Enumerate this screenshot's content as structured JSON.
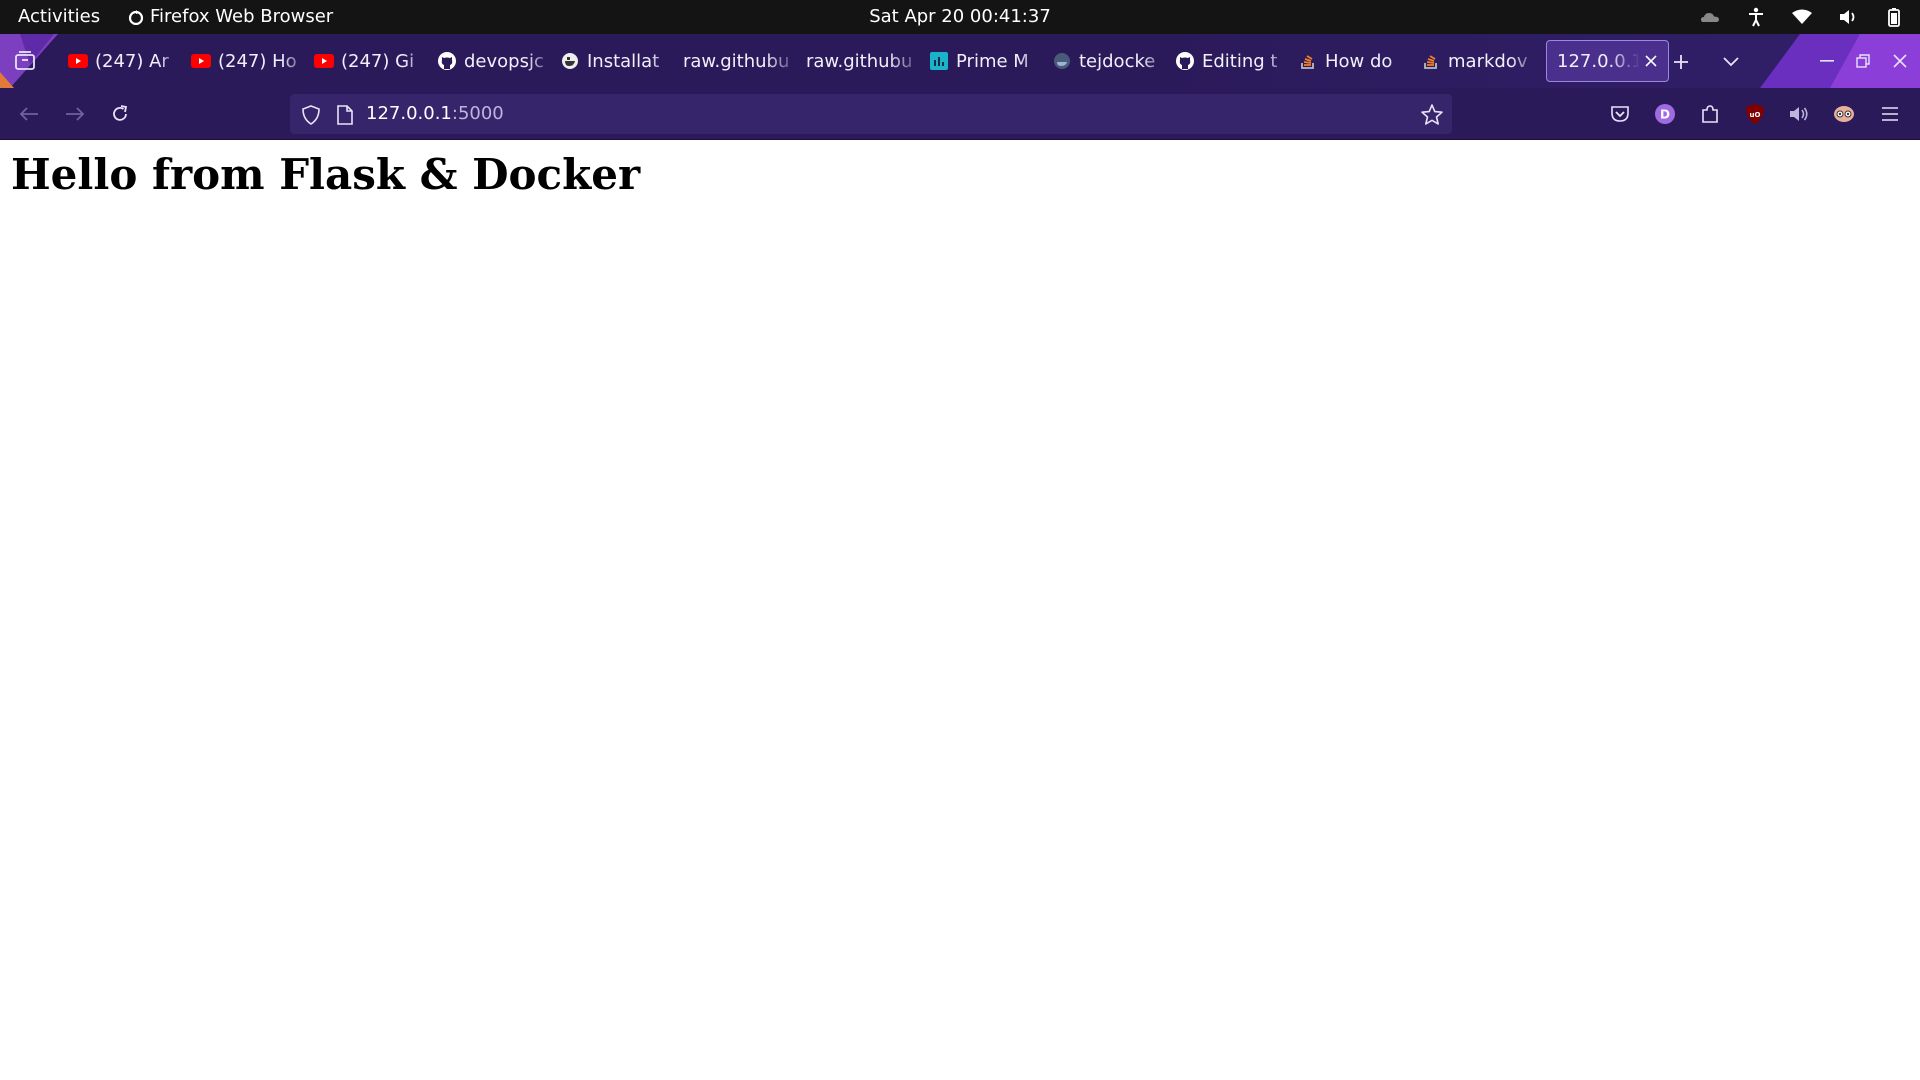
{
  "topbar": {
    "activities": "Activities",
    "app_name": "Firefox Web Browser",
    "clock": "Sat Apr 20  00:41:37"
  },
  "tabs": [
    {
      "label": "(247) Ar",
      "icon": "youtube-icon"
    },
    {
      "label": "(247) Ho",
      "icon": "youtube-icon"
    },
    {
      "label": "(247) Gi",
      "icon": "youtube-icon"
    },
    {
      "label": "devopsjc",
      "icon": "github-icon"
    },
    {
      "label": "Installat",
      "icon": "docker-icon"
    },
    {
      "label": "raw.githubu",
      "icon": ""
    },
    {
      "label": "raw.githubu",
      "icon": ""
    },
    {
      "label": "Prime M",
      "icon": "prime-icon"
    },
    {
      "label": "tejdocke",
      "icon": "docker-icon"
    },
    {
      "label": "Editing t",
      "icon": "github-icon"
    },
    {
      "label": "How do",
      "icon": "stackoverflow-icon"
    },
    {
      "label": "markdov",
      "icon": "stackoverflow-icon"
    }
  ],
  "active_tab": {
    "label": "127.0.0.1"
  },
  "address": {
    "host": "127.0.0.1",
    "port": ":5000"
  },
  "page": {
    "heading": "Hello from Flask & Docker"
  },
  "colors": {
    "toolbar_bg": "#2b1a5a",
    "urlbar_bg": "#36256b",
    "active_tab_bg": "#4a2f8c",
    "youtube_red": "#ff0000"
  }
}
